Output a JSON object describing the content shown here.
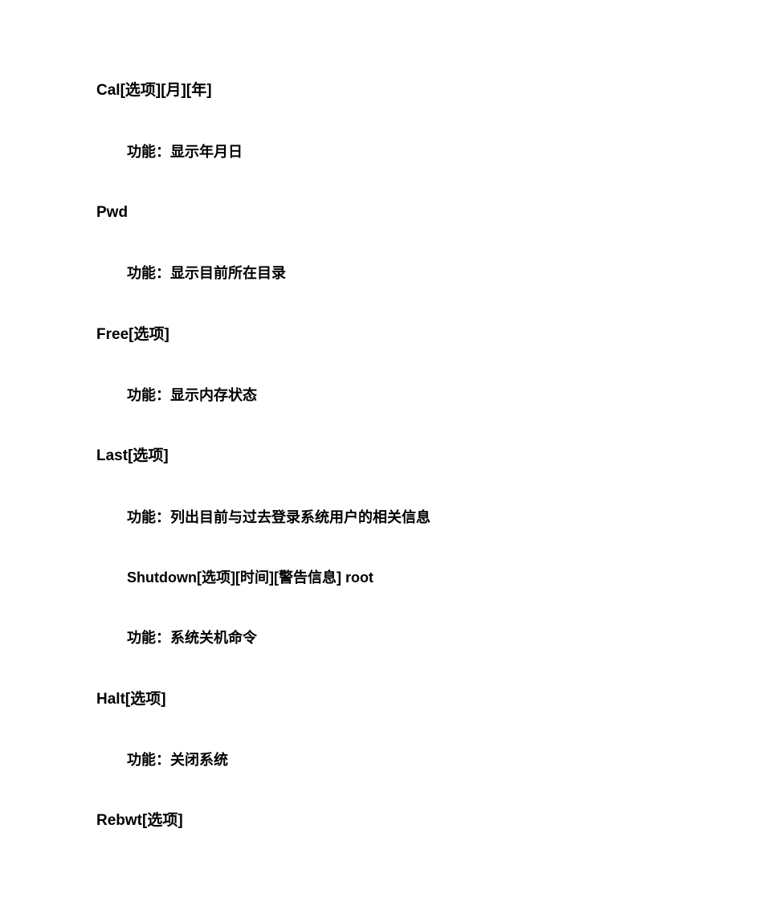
{
  "commands": [
    {
      "heading": "Cal[选项][月][年]",
      "desc": "功能：显示年月日"
    },
    {
      "heading": "Pwd",
      "desc": "功能：显示目前所在目录"
    },
    {
      "heading": "Free[选项]",
      "desc": "功能：显示内存状态"
    },
    {
      "heading": "Last[选项]",
      "desc": "功能：列出目前与过去登录系统用户的相关信息",
      "subheading": "Shutdown[选项][时间][警告信息] root",
      "subdesc": "功能：系统关机命令"
    },
    {
      "heading": "Halt[选项]",
      "desc": "功能：关闭系统"
    },
    {
      "heading": "Rebwt[选项]"
    }
  ]
}
